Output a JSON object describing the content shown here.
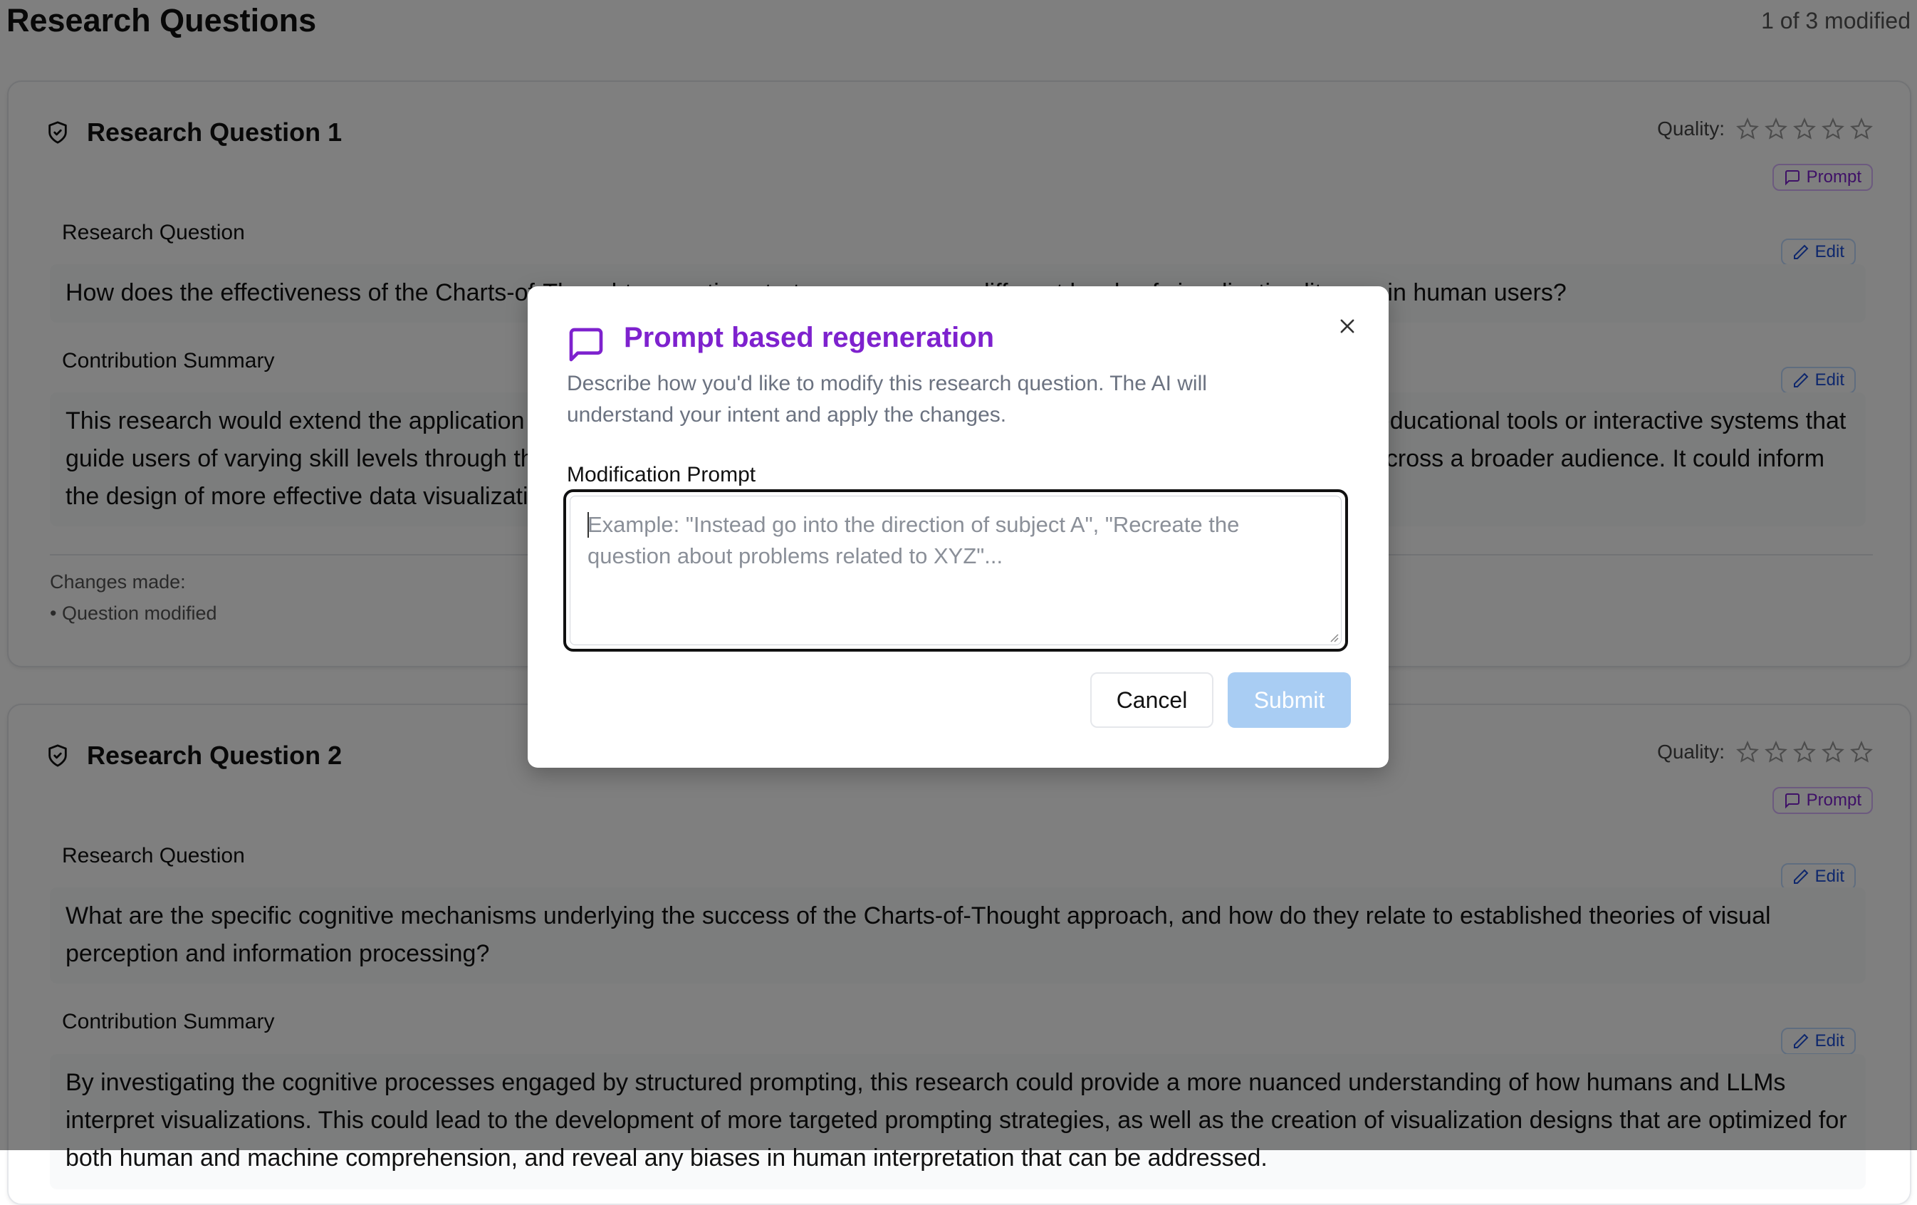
{
  "page": {
    "title": "Research Questions",
    "count_label": "1 of 3 modified"
  },
  "cards": [
    {
      "title": "Research Question 1",
      "quality_label": "Quality:",
      "quality_rating": 0,
      "quality_max": 5,
      "prompt_label": "Prompt",
      "question_label": "Research Question",
      "question_edit": "Edit",
      "question_text": "How does the effectiveness of the Charts-of-Thought prompting strategy vary across different levels of visualization literacy in human users?",
      "summary_label": "Contribution Summary",
      "summary_edit": "Edit",
      "summary_text": "This research would extend the application of Charts-of-Thought to human users, potentially informing the development of educational tools or interactive systems that guide users of varying skill levels through the process of interpreting visualizations, making data analysis more accessible across a broader audience. It could inform the design of more effective data visualization literacy interventions.",
      "changes_label": "Changes made:",
      "changes_item": "• Question modified"
    },
    {
      "title": "Research Question 2",
      "quality_label": "Quality:",
      "quality_rating": 0,
      "quality_max": 5,
      "prompt_label": "Prompt",
      "question_label": "Research Question",
      "question_edit": "Edit",
      "question_text": "What are the specific cognitive mechanisms underlying the success of the Charts-of-Thought approach, and how do they relate to established theories of visual perception and information processing?",
      "summary_label": "Contribution Summary",
      "summary_edit": "Edit",
      "summary_text": "By investigating the cognitive processes engaged by structured prompting, this research could provide a more nuanced understanding of how humans and LLMs interpret visualizations. This could lead to the development of more targeted prompting strategies, as well as the creation of visualization designs that are optimized for both human and machine comprehension, and reveal any biases in human interpretation that can be addressed."
    }
  ],
  "modal": {
    "title": "Prompt based regeneration",
    "description": "Describe how you'd like to modify this research question. The AI will understand your intent and apply the changes.",
    "field_label": "Modification Prompt",
    "placeholder": "Example: \"Instead go into the direction of subject A\", \"Recreate the question about problems related to XYZ\"...",
    "cancel_label": "Cancel",
    "submit_label": "Submit"
  },
  "colors": {
    "accent_purple": "#7e22ce",
    "edit_blue": "#1d4ed8",
    "submit_disabled": "#a9cdf3"
  }
}
